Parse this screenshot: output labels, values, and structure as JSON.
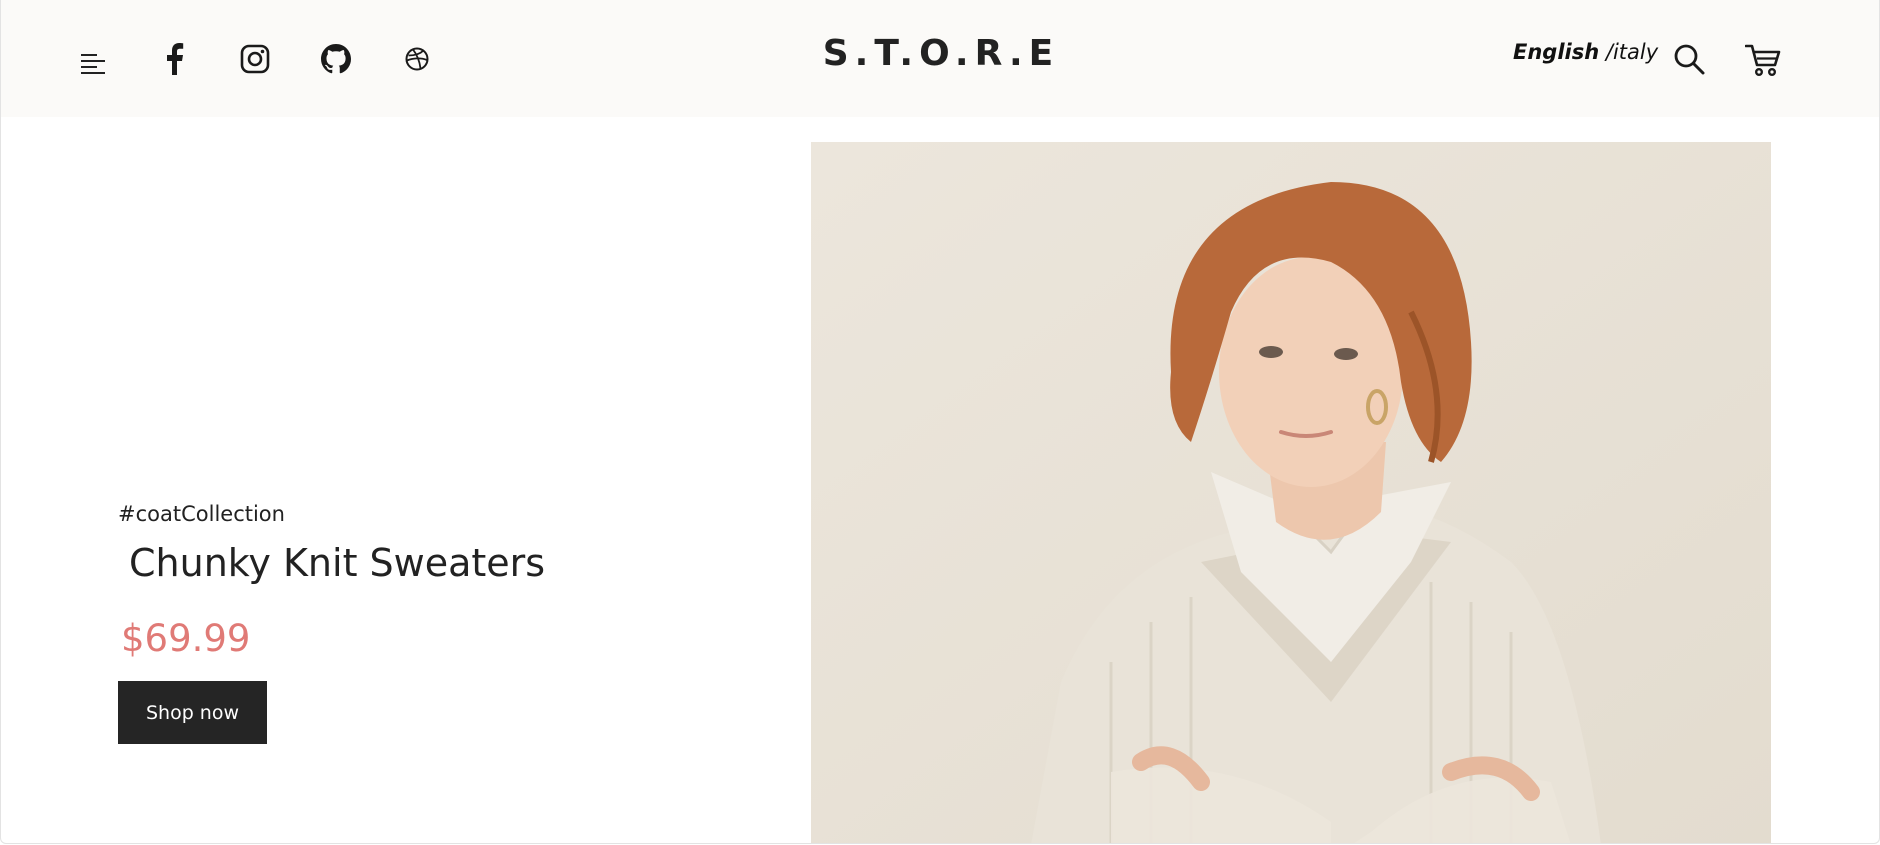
{
  "header": {
    "logo": "S.T.O.R.E",
    "language": {
      "active": "English",
      "separator": " /",
      "other": "italy"
    },
    "icons": [
      "menu-icon",
      "facebook-icon",
      "instagram-icon",
      "github-icon",
      "dribbble-icon",
      "search-icon",
      "cart-icon"
    ]
  },
  "hero": {
    "hashtag": "#coatCollection",
    "title": "Chunky Knit Sweaters",
    "price": "$69.99",
    "cta_label": "Shop now"
  },
  "colors": {
    "header_bg": "#fbfaf8",
    "price": "#e07a76",
    "button_bg": "#252525",
    "image_bg": "#e8e1d7"
  }
}
